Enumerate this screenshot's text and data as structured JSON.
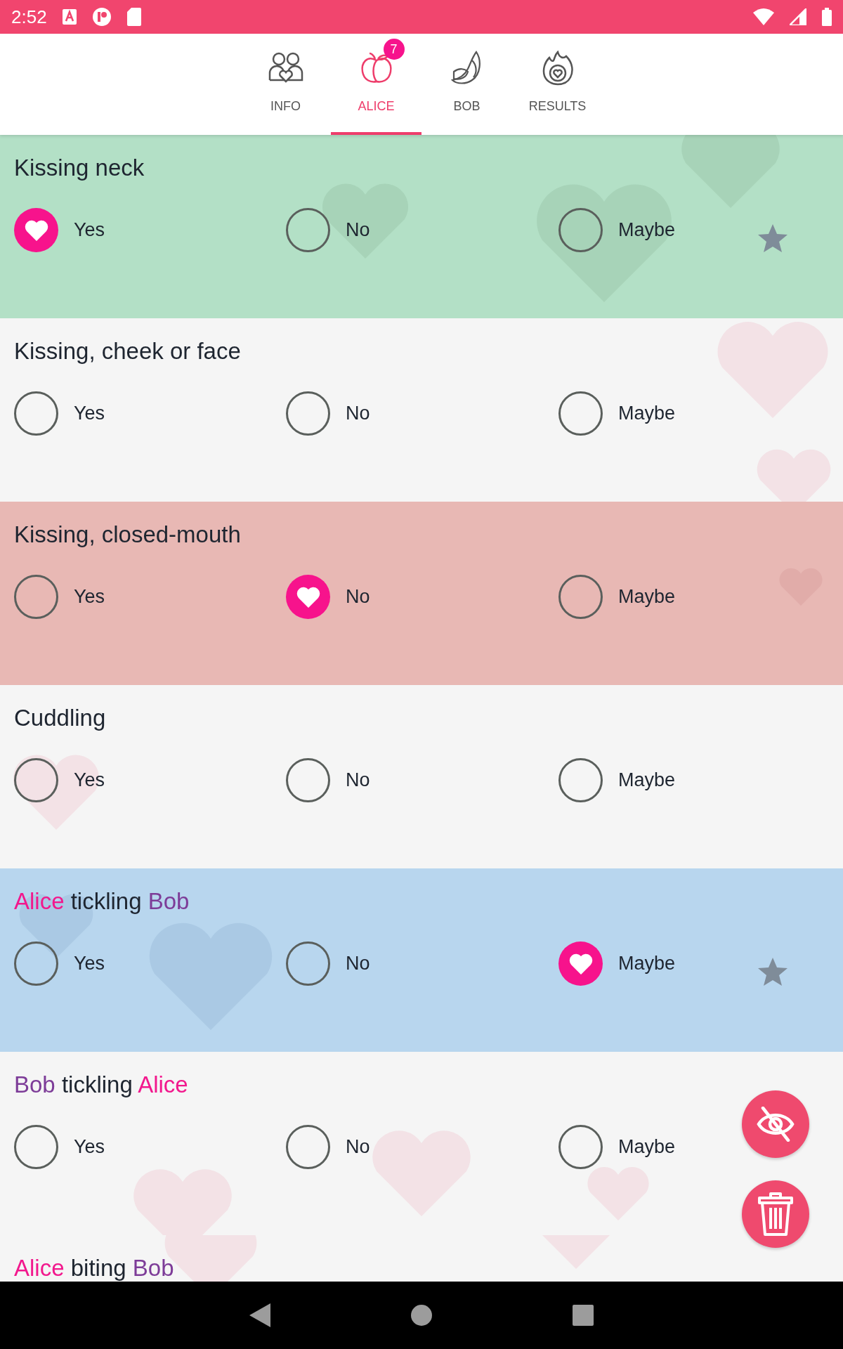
{
  "status_bar": {
    "time": "2:52"
  },
  "tabs": [
    {
      "label": "INFO",
      "kind": "people",
      "selected": false
    },
    {
      "label": "ALICE",
      "kind": "peach",
      "selected": true,
      "badge": "7"
    },
    {
      "label": "BOB",
      "kind": "banana",
      "selected": false
    },
    {
      "label": "RESULTS",
      "kind": "flame",
      "selected": false
    }
  ],
  "questions": [
    {
      "title": [
        {
          "text": "Kissing neck",
          "kind": "plain"
        }
      ],
      "starred": true,
      "options": [
        {
          "label": "Yes",
          "selected": true
        },
        {
          "label": "No",
          "selected": false
        },
        {
          "label": "Maybe",
          "selected": false
        }
      ]
    },
    {
      "title": [
        {
          "text": "Kissing, cheek or face",
          "kind": "plain"
        }
      ],
      "starred": false,
      "options": [
        {
          "label": "Yes",
          "selected": false
        },
        {
          "label": "No",
          "selected": false
        },
        {
          "label": "Maybe",
          "selected": false
        }
      ]
    },
    {
      "title": [
        {
          "text": "Kissing, closed-mouth",
          "kind": "plain"
        }
      ],
      "starred": false,
      "options": [
        {
          "label": "Yes",
          "selected": false
        },
        {
          "label": "No",
          "selected": true
        },
        {
          "label": "Maybe",
          "selected": false
        }
      ]
    },
    {
      "title": [
        {
          "text": "Cuddling",
          "kind": "plain"
        }
      ],
      "starred": false,
      "options": [
        {
          "label": "Yes",
          "selected": false
        },
        {
          "label": "No",
          "selected": false
        },
        {
          "label": "Maybe",
          "selected": false
        }
      ]
    },
    {
      "title": [
        {
          "text": "Alice",
          "kind": "first"
        },
        {
          "text": "tickling",
          "kind": "plain"
        },
        {
          "text": "Bob",
          "kind": "second"
        }
      ],
      "starred": true,
      "options": [
        {
          "label": "Yes",
          "selected": false
        },
        {
          "label": "No",
          "selected": false
        },
        {
          "label": "Maybe",
          "selected": true
        }
      ]
    },
    {
      "title": [
        {
          "text": "Bob",
          "kind": "second"
        },
        {
          "text": "tickling",
          "kind": "plain"
        },
        {
          "text": "Alice",
          "kind": "first"
        }
      ],
      "starred": false,
      "options": [
        {
          "label": "Yes",
          "selected": false
        },
        {
          "label": "No",
          "selected": false
        },
        {
          "label": "Maybe",
          "selected": false
        }
      ]
    },
    {
      "title": [
        {
          "text": "Alice",
          "kind": "first"
        },
        {
          "text": "biting",
          "kind": "plain"
        },
        {
          "text": "Bob",
          "kind": "second"
        }
      ],
      "starred": false
    }
  ]
}
